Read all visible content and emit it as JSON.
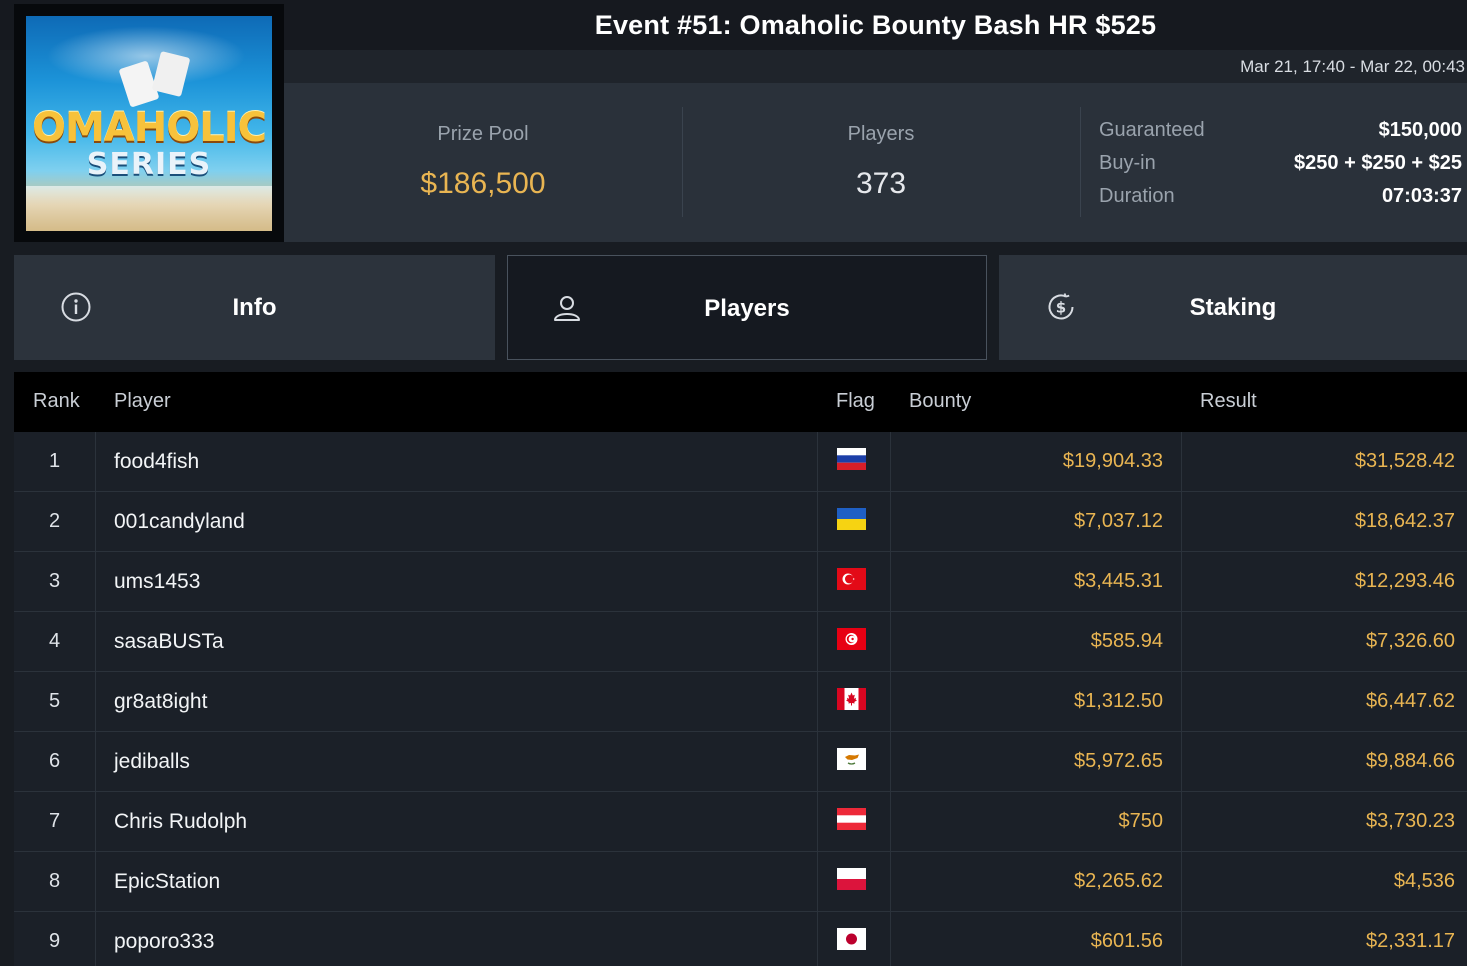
{
  "event": {
    "title": "Event #51: Omaholic Bounty Bash HR $525",
    "dates": "Mar 21, 17:40 - Mar 22, 00:43"
  },
  "logo": {
    "line1": "OMAHOLIC",
    "line2": "SERIES"
  },
  "stats": {
    "prize_pool_label": "Prize Pool",
    "prize_pool_value": "$186,500",
    "players_label": "Players",
    "players_value": "373",
    "guaranteed_label": "Guaranteed",
    "guaranteed_value": "$150,000",
    "buyin_label": "Buy-in",
    "buyin_value": "$250 + $250 + $25",
    "duration_label": "Duration",
    "duration_value": "07:03:37"
  },
  "tabs": {
    "info": "Info",
    "players": "Players",
    "staking": "Staking",
    "active": "players"
  },
  "table": {
    "headers": {
      "rank": "Rank",
      "player": "Player",
      "flag": "Flag",
      "bounty": "Bounty",
      "result": "Result"
    },
    "rows": [
      {
        "rank": "1",
        "player": "food4fish",
        "flag": "russia",
        "bounty": "$19,904.33",
        "result": "$31,528.42"
      },
      {
        "rank": "2",
        "player": "001candyland",
        "flag": "ukraine",
        "bounty": "$7,037.12",
        "result": "$18,642.37"
      },
      {
        "rank": "3",
        "player": "ums1453",
        "flag": "turkey",
        "bounty": "$3,445.31",
        "result": "$12,293.46"
      },
      {
        "rank": "4",
        "player": "sasaBUSTa",
        "flag": "tunisia",
        "bounty": "$585.94",
        "result": "$7,326.60"
      },
      {
        "rank": "5",
        "player": "gr8at8ight",
        "flag": "canada",
        "bounty": "$1,312.50",
        "result": "$6,447.62"
      },
      {
        "rank": "6",
        "player": "jediballs",
        "flag": "cyprus",
        "bounty": "$5,972.65",
        "result": "$9,884.66"
      },
      {
        "rank": "7",
        "player": "Chris Rudolph",
        "flag": "austria",
        "bounty": "$750",
        "result": "$3,730.23"
      },
      {
        "rank": "8",
        "player": "EpicStation",
        "flag": "poland",
        "bounty": "$2,265.62",
        "result": "$4,536"
      },
      {
        "rank": "9",
        "player": "poporo333",
        "flag": "japan",
        "bounty": "$601.56",
        "result": "$2,331.17"
      }
    ]
  },
  "colors": {
    "accent_gold": "#e9b552",
    "panel": "#2a313a",
    "background": "#181c22"
  }
}
